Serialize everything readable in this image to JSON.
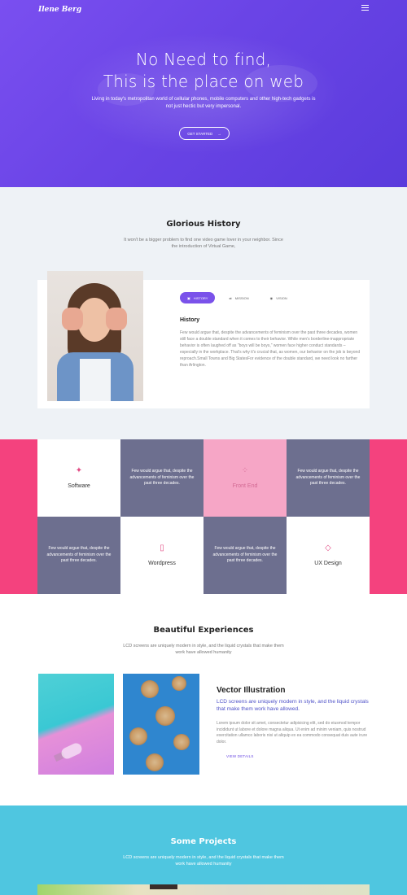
{
  "header": {
    "logo": "Ilene Berg",
    "hero_line1": "No Need to find,",
    "hero_line2": "This is the place on web",
    "intro": "Living in today's metropolitan world of cellular phones, mobile computers and other high-tech gadgets is not just hectic but very impersonal.",
    "cta_label": "GET STARTED",
    "cta_icon": "arrow-right-icon"
  },
  "history": {
    "title": "Glorious History",
    "subtitle": "It won't be a bigger problem to find one video game lover in your neighbor. Since the introduction of Virtual Game,",
    "tabs": [
      {
        "label": "HISTORY",
        "icon": "image-icon",
        "active": true
      },
      {
        "label": "MISSION",
        "icon": "transfer-icon",
        "active": false
      },
      {
        "label": "VISION",
        "icon": "eye-icon",
        "active": false
      }
    ],
    "heading": "History",
    "paragraph": "Few would argue that, despite the advancements of feminism over the past three decades, women still face a double standard when it comes to their behavior. While men's borderline-inappropriate behavior is often laughed off as \"boys will be boys,\" women face higher conduct standards – especially in the workplace. That's why it's crucial that, as women, our behavior on the job is beyond reproach.Small Towns and Big StatesFor evidence of the double standard, we need look no farther than Arlington."
  },
  "services": {
    "software": "Software",
    "frontend": "Front End",
    "wordpress": "Wordpress",
    "uxdesign": "UX Design",
    "text1": "Few would argue that, despite the advancements of feminism over the past three decades.",
    "text2": "Few would argue that, despite the advancements of feminism over the past three decades.",
    "text3": "Few would argue that, despite the advancements of feminism over the past three decades.",
    "text4": "Few would argue that, despite the advancements of feminism over the past three decades."
  },
  "experiences": {
    "title": "Beautiful Experiences",
    "subtitle": "LCD screens are uniquely modern in style, and the liquid crystals that make them work have allowed humanity",
    "heading": "Vector Illustration",
    "lead": "LCD screens are uniquely modern in style, and the liquid crystals that make them work have allowed.",
    "paragraph": "Lorem ipsum dolor sit amet, consectetur adipisicing elit, sed do eiusmod tempor incididunt ut labore et dolore magna aliqua. Ut enim ad minim veniam, quis nostrud exercitation ullamco laboris nisi ut aliquip ex ea commodo consequat duis aute irure dolor.",
    "link": "VIEW DETAILS"
  },
  "projects": {
    "title": "Some Projects",
    "subtitle": "LCD screens are uniquely modern in style, and the liquid crystals that make them work have allowed humanity"
  },
  "colors": {
    "hero_purple": "#6a44e6",
    "accent_pink": "#f4427e",
    "slate": "#6d6f8f",
    "projects_cyan": "#4fc6e0",
    "link_purple": "#6a4ae2"
  }
}
